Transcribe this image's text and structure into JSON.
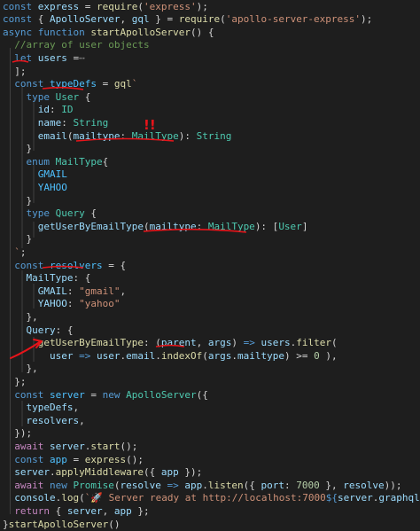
{
  "editor": {
    "language": "javascript",
    "lines": [
      [
        [
          "kw",
          "const "
        ],
        [
          "var",
          "express"
        ],
        [
          "pun",
          " = "
        ],
        [
          "fn",
          "require"
        ],
        [
          "pun",
          "("
        ],
        [
          "str",
          "'express'"
        ],
        [
          "pun",
          ");"
        ]
      ],
      [
        [
          "kw",
          "const "
        ],
        [
          "pun",
          "{ "
        ],
        [
          "var",
          "ApolloServer"
        ],
        [
          "pun",
          ", "
        ],
        [
          "var",
          "gql"
        ],
        [
          "pun",
          " } = "
        ],
        [
          "fn",
          "require"
        ],
        [
          "pun",
          "("
        ],
        [
          "str",
          "'apollo-server-express'"
        ],
        [
          "pun",
          ");"
        ]
      ],
      [
        [
          "kw",
          "async "
        ],
        [
          "kw",
          "function "
        ],
        [
          "fn",
          "startApolloServer"
        ],
        [
          "pun",
          "() {"
        ]
      ],
      [
        [
          "pun",
          "  "
        ],
        [
          "cmt",
          "//array of user objects"
        ]
      ],
      [
        [
          "pun",
          "  "
        ],
        [
          "kw",
          "let "
        ],
        [
          "var",
          "users"
        ],
        [
          "pun",
          " ="
        ],
        [
          "fold",
          "⋯"
        ]
      ],
      [
        [
          "pun",
          "  ];"
        ]
      ],
      [
        [
          "pun",
          "  "
        ],
        [
          "kw",
          "const "
        ],
        [
          "cst",
          "typeDefs"
        ],
        [
          "pun",
          " = "
        ],
        [
          "fn",
          "gql"
        ],
        [
          "str",
          "`"
        ]
      ],
      [
        [
          "str",
          "    "
        ],
        [
          "kw",
          "type "
        ],
        [
          "typ",
          "User"
        ],
        [
          "pun",
          " {"
        ]
      ],
      [
        [
          "pun",
          "      "
        ],
        [
          "var",
          "id"
        ],
        [
          "pun",
          ": "
        ],
        [
          "typ",
          "ID"
        ]
      ],
      [
        [
          "pun",
          "      "
        ],
        [
          "var",
          "name"
        ],
        [
          "pun",
          ": "
        ],
        [
          "typ",
          "String"
        ]
      ],
      [
        [
          "pun",
          "      "
        ],
        [
          "var",
          "email"
        ],
        [
          "pun",
          "("
        ],
        [
          "var",
          "mailtype"
        ],
        [
          "pun",
          ": "
        ],
        [
          "typ",
          "MailType"
        ],
        [
          "pun",
          "): "
        ],
        [
          "typ",
          "String"
        ]
      ],
      [
        [
          "pun",
          "    }"
        ]
      ],
      [
        [
          "pun",
          "    "
        ],
        [
          "kw",
          "enum "
        ],
        [
          "typ",
          "MailType"
        ],
        [
          "pun",
          "{"
        ]
      ],
      [
        [
          "pun",
          "      "
        ],
        [
          "cst",
          "GMAIL"
        ]
      ],
      [
        [
          "pun",
          "      "
        ],
        [
          "cst",
          "YAHOO"
        ]
      ],
      [
        [
          "pun",
          "    }"
        ]
      ],
      [
        [
          "pun",
          "    "
        ],
        [
          "kw",
          "type "
        ],
        [
          "typ",
          "Query"
        ],
        [
          "pun",
          " {"
        ]
      ],
      [
        [
          "pun",
          "      "
        ],
        [
          "var",
          "getUserByEmailType"
        ],
        [
          "pun",
          "("
        ],
        [
          "var",
          "mailtype"
        ],
        [
          "pun",
          ": "
        ],
        [
          "typ",
          "MailType"
        ],
        [
          "pun",
          "): ["
        ],
        [
          "typ",
          "User"
        ],
        [
          "pun",
          "]"
        ]
      ],
      [
        [
          "pun",
          "    }"
        ]
      ],
      [
        [
          "pun",
          "  "
        ],
        [
          "str",
          "`"
        ],
        [
          "pun",
          ";"
        ]
      ],
      [
        [
          "pun",
          "  "
        ],
        [
          "kw",
          "const "
        ],
        [
          "cst",
          "resolvers"
        ],
        [
          "pun",
          " = {"
        ]
      ],
      [
        [
          "pun",
          "    "
        ],
        [
          "var",
          "MailType"
        ],
        [
          "pun",
          ": {"
        ]
      ],
      [
        [
          "pun",
          "      "
        ],
        [
          "var",
          "GMAIL"
        ],
        [
          "pun",
          ": "
        ],
        [
          "str",
          "\"gmail\""
        ],
        [
          "pun",
          ","
        ]
      ],
      [
        [
          "pun",
          "      "
        ],
        [
          "var",
          "YAHOO"
        ],
        [
          "pun",
          ": "
        ],
        [
          "str",
          "\"yahoo\""
        ]
      ],
      [
        [
          "pun",
          "    },"
        ]
      ],
      [
        [
          "pun",
          "    "
        ],
        [
          "var",
          "Query"
        ],
        [
          "pun",
          ": {"
        ]
      ],
      [
        [
          "pun",
          "      "
        ],
        [
          "fn",
          "getUserByEmailType"
        ],
        [
          "pun",
          ": ("
        ],
        [
          "var",
          "parent"
        ],
        [
          "pun",
          ", "
        ],
        [
          "var",
          "args"
        ],
        [
          "pun",
          ") "
        ],
        [
          "kw",
          "=>"
        ],
        [
          "pun",
          " "
        ],
        [
          "var",
          "users"
        ],
        [
          "pun",
          "."
        ],
        [
          "fn",
          "filter"
        ],
        [
          "pun",
          "("
        ]
      ],
      [
        [
          "pun",
          "        "
        ],
        [
          "var",
          "user"
        ],
        [
          "pun",
          " "
        ],
        [
          "kw",
          "=>"
        ],
        [
          "pun",
          " "
        ],
        [
          "var",
          "user"
        ],
        [
          "pun",
          "."
        ],
        [
          "var",
          "email"
        ],
        [
          "pun",
          "."
        ],
        [
          "fn",
          "indexOf"
        ],
        [
          "pun",
          "("
        ],
        [
          "var",
          "args"
        ],
        [
          "pun",
          "."
        ],
        [
          "var",
          "mailtype"
        ],
        [
          "pun",
          ") >= "
        ],
        [
          "num",
          "0"
        ],
        [
          "pun",
          " ),"
        ]
      ],
      [
        [
          "pun",
          "    },"
        ]
      ],
      [
        [
          "pun",
          "  };"
        ]
      ],
      [
        [
          "pun",
          "  "
        ],
        [
          "kw",
          "const "
        ],
        [
          "cst",
          "server"
        ],
        [
          "pun",
          " = "
        ],
        [
          "kw",
          "new "
        ],
        [
          "typ",
          "ApolloServer"
        ],
        [
          "pun",
          "({"
        ]
      ],
      [
        [
          "pun",
          "    "
        ],
        [
          "var",
          "typeDefs"
        ],
        [
          "pun",
          ","
        ]
      ],
      [
        [
          "pun",
          "    "
        ],
        [
          "var",
          "resolvers"
        ],
        [
          "pun",
          ","
        ]
      ],
      [
        [
          "pun",
          "  });"
        ]
      ],
      [
        [
          "pun",
          "  "
        ],
        [
          "ctl",
          "await "
        ],
        [
          "var",
          "server"
        ],
        [
          "pun",
          "."
        ],
        [
          "fn",
          "start"
        ],
        [
          "pun",
          "();"
        ]
      ],
      [
        [
          "pun",
          "  "
        ],
        [
          "kw",
          "const "
        ],
        [
          "cst",
          "app"
        ],
        [
          "pun",
          " = "
        ],
        [
          "fn",
          "express"
        ],
        [
          "pun",
          "();"
        ]
      ],
      [
        [
          "pun",
          "  "
        ],
        [
          "var",
          "server"
        ],
        [
          "pun",
          "."
        ],
        [
          "fn",
          "applyMiddleware"
        ],
        [
          "pun",
          "({ "
        ],
        [
          "var",
          "app"
        ],
        [
          "pun",
          " });"
        ]
      ],
      [
        [
          "pun",
          "  "
        ],
        [
          "ctl",
          "await "
        ],
        [
          "kw",
          "new "
        ],
        [
          "typ",
          "Promise"
        ],
        [
          "pun",
          "("
        ],
        [
          "var",
          "resolve"
        ],
        [
          "pun",
          " "
        ],
        [
          "kw",
          "=>"
        ],
        [
          "pun",
          " "
        ],
        [
          "var",
          "app"
        ],
        [
          "pun",
          "."
        ],
        [
          "fn",
          "listen"
        ],
        [
          "pun",
          "({ "
        ],
        [
          "var",
          "port"
        ],
        [
          "pun",
          ": "
        ],
        [
          "num",
          "7000"
        ],
        [
          "pun",
          " }, "
        ],
        [
          "var",
          "resolve"
        ],
        [
          "pun",
          "));"
        ]
      ],
      [
        [
          "pun",
          "  "
        ],
        [
          "var",
          "console"
        ],
        [
          "pun",
          "."
        ],
        [
          "fn",
          "log"
        ],
        [
          "pun",
          "("
        ],
        [
          "str",
          "`🚀 Server ready at http://localhost:7000"
        ],
        [
          "kw",
          "${"
        ],
        [
          "var",
          "server"
        ],
        [
          "pun",
          "."
        ],
        [
          "var",
          "graphqlPath"
        ],
        [
          "kw",
          "}"
        ],
        [
          "str",
          "`"
        ],
        [
          "pun",
          ");"
        ]
      ],
      [
        [
          "pun",
          "  "
        ],
        [
          "ctl",
          "return "
        ],
        [
          "pun",
          "{ "
        ],
        [
          "var",
          "server"
        ],
        [
          "pun",
          ", "
        ],
        [
          "var",
          "app"
        ],
        [
          "pun",
          " };"
        ]
      ],
      [
        [
          "pun",
          "}"
        ],
        [
          "fn",
          "startApolloServer"
        ],
        [
          "pun",
          "()"
        ]
      ]
    ]
  },
  "annotations": {
    "exclamation_mark": "!!",
    "ink_color": "#e8141a"
  }
}
